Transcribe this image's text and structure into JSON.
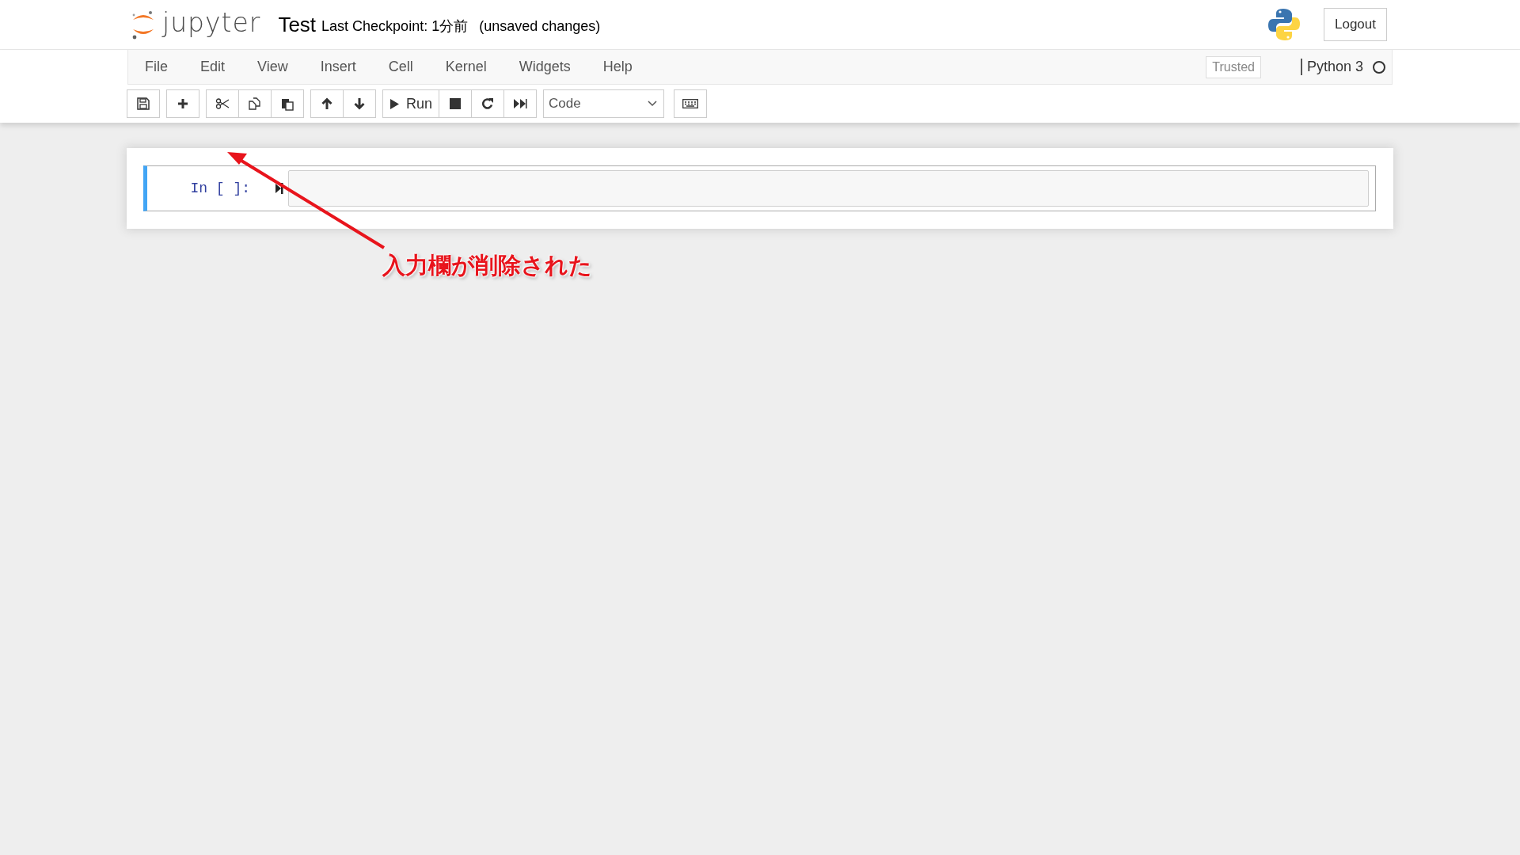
{
  "header": {
    "logo_text": "jupyter",
    "notebook_name": "Test",
    "checkpoint": "Last Checkpoint: 1分前",
    "save_status": "(unsaved changes)",
    "logout": "Logout"
  },
  "menubar": {
    "items": [
      "File",
      "Edit",
      "View",
      "Insert",
      "Cell",
      "Kernel",
      "Widgets",
      "Help"
    ],
    "trusted": "Trusted",
    "kernel_name": "Python 3",
    "kernel_busy": false
  },
  "toolbar": {
    "run_label": "Run",
    "cell_type": "Code"
  },
  "cells": [
    {
      "prompt": "In [ ]:",
      "selected": true
    }
  ],
  "annotation": {
    "text": "入力欄が削除された"
  }
}
